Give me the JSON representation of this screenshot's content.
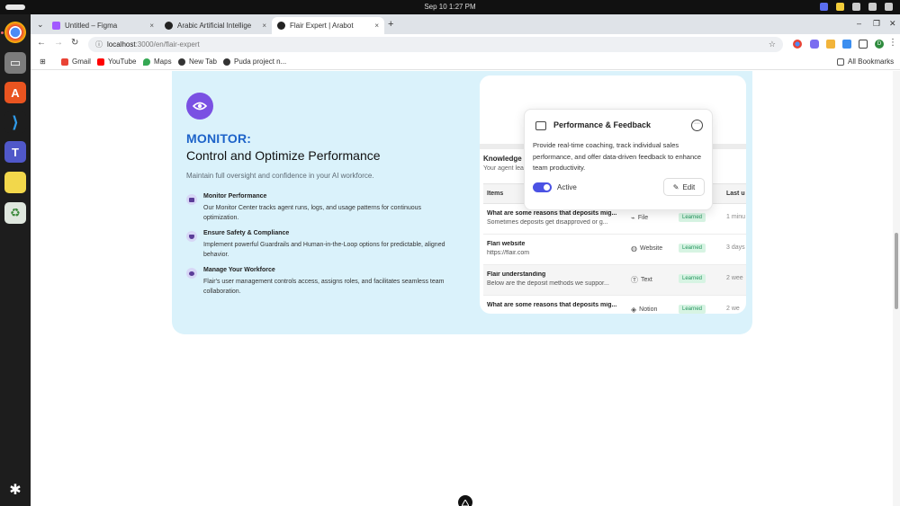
{
  "os": {
    "clock": "Sep 10   1:27 PM"
  },
  "dock": {
    "apps": [
      "chrome-icon",
      "files-icon",
      "app-store-icon",
      "vscode-icon",
      "teams-icon",
      "notes-icon",
      "trash-icon",
      "ubuntu-icon"
    ]
  },
  "browser": {
    "tabs": [
      {
        "title": "Untitled – Figma",
        "close": "×"
      },
      {
        "title": "Arabic Artificial Intellige",
        "close": "×"
      },
      {
        "title": "Flair Expert | Arabot",
        "close": "×"
      }
    ],
    "new_tab": "+",
    "url_host": "localhost",
    "url_path": ":3000/en/flair-expert",
    "profile_initial": "D",
    "bookmarks": [
      "Gmail",
      "YouTube",
      "Maps",
      "New Tab",
      "Puda project n..."
    ],
    "all_bookmarks": "All Bookmarks"
  },
  "feature": {
    "eyebrow": "MONITOR:",
    "heading": "Control and Optimize Performance",
    "subheading": "Maintain full oversight and confidence in your AI workforce.",
    "items": [
      {
        "title": "Monitor Performance",
        "desc": "Our Monitor Center tracks agent runs, logs, and usage patterns for continuous optimization."
      },
      {
        "title": "Ensure Safety & Compliance",
        "desc": "Implement powerful Guardrails and Human-in-the-Loop options for predictable, aligned behavior."
      },
      {
        "title": "Manage Your Workforce",
        "desc": "Flair's user management controls access, assigns roles, and facilitates seamless team collaboration."
      }
    ]
  },
  "mock": {
    "kb_title": "Knowledge",
    "kb_sub": "Your agent lea",
    "columns": {
      "items": "Items",
      "last": "Last u"
    },
    "rows": [
      {
        "title": "What are some reasons that deposits mig...",
        "sub": "Sometimes deposits get disapproved or g...",
        "type": "File",
        "type_icon": "⌁",
        "status": "Learned",
        "date": "1 minu"
      },
      {
        "title": "Flari website",
        "sub": "https://flair.com",
        "type": "Website",
        "type_icon": "◍",
        "status": "Learned",
        "date": "3 days"
      },
      {
        "title": "Flair understanding",
        "sub": "Below are the deposit methods we suppor...",
        "type": "Text",
        "type_icon": "Ⓣ",
        "status": "Learned",
        "date": "2 wee"
      },
      {
        "title": "What are some reasons that deposits mig...",
        "sub": "",
        "type": "Notion",
        "type_icon": "◈",
        "status": "Learned",
        "date": "2 we"
      }
    ],
    "popup": {
      "title": "Performance & Feedback",
      "description": "Provide real-time coaching, track individual sales performance, and offer data-driven feedback to enhance team productivity.",
      "toggle_label": "Active",
      "toggle_on": true,
      "edit_label": "Edit"
    }
  },
  "scroll": {
    "position": 0.45
  },
  "colors": {
    "accent": "#7a51e3",
    "eyebrow": "#1d63c9",
    "card_bg": "#daf2fb",
    "toggle": "#4b52e4",
    "learned_bg": "#d7f4e3",
    "learned_text": "#21935b"
  }
}
